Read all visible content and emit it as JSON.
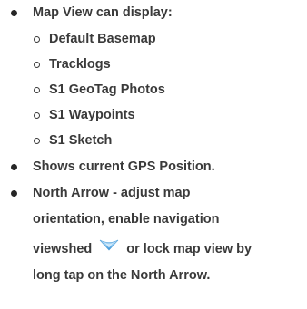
{
  "items": [
    {
      "label": "Map View can display:",
      "subitems": [
        "Default Basemap",
        "Tracklogs",
        "S1 GeoTag Photos",
        "S1 Waypoints",
        "S1 Sketch"
      ]
    },
    {
      "label": "Shows current GPS Position."
    },
    {
      "lines": [
        "North Arrow - adjust map",
        "orientation, enable navigation",
        "viewshed",
        "or lock map view by",
        "long tap on the North Arrow."
      ]
    }
  ],
  "icons": {
    "viewshed": "viewshed-icon"
  },
  "colors": {
    "text": "#3a3a3a",
    "bullet": "#262626"
  }
}
